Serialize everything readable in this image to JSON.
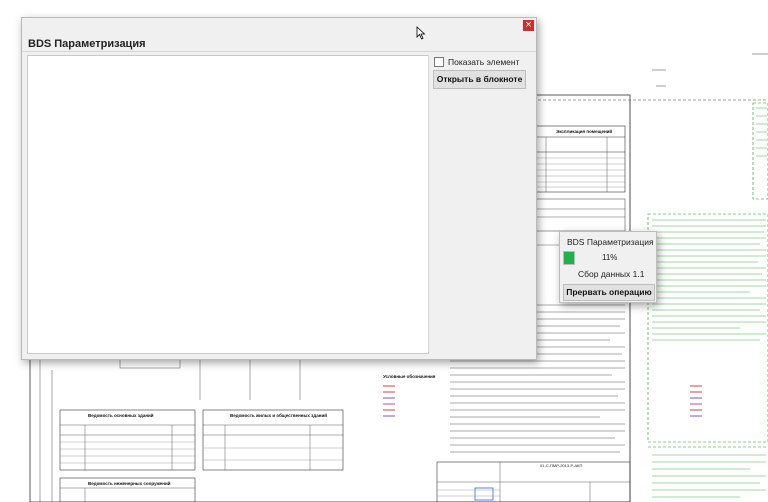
{
  "main_dialog": {
    "title": "BDS Параметризация",
    "close_glyph": "×",
    "show_element_label": "Показать элемент",
    "show_element_checked": false,
    "open_notepad_label": "Открыть в блокноте"
  },
  "progress_dialog": {
    "title": "BDS Параметризация",
    "percent": "11%",
    "progress_fraction": 0.11,
    "status": "Сбор данных 1.1",
    "abort_label": "Прервать операцию"
  },
  "background_drawing": {
    "spec_table_title": "Экспликация помещений",
    "legend_title": "Условные обозначения",
    "table1_title": "Ведомость основных зданий",
    "table2_title": "Ведомость жилых и общественных зданий",
    "table3_title": "Ведомость инженерных сооружений",
    "stamp_code": "01-С-ПМР-2013-Р-АКП",
    "colors": {
      "accent_green": "#22b04b",
      "close_red": "#c9302c",
      "green_dashed": "#1a9a1a"
    }
  }
}
